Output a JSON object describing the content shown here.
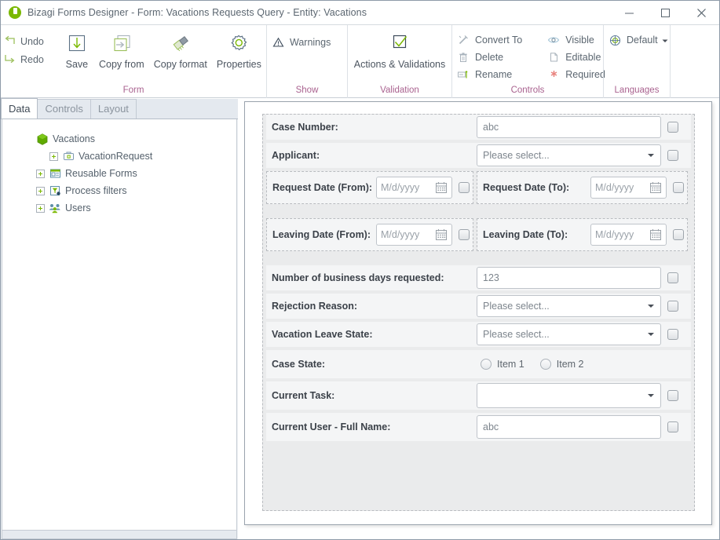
{
  "window": {
    "title": "Bizagi Forms Designer  - Form: Vacations Requests Query - Entity:  Vacations",
    "logo_icon": "bizagi-logo-icon",
    "minimize_label": "Minimize",
    "maximize_label": "Maximize",
    "close_label": "Close"
  },
  "ribbon": {
    "groups": [
      {
        "title": "Form",
        "small_commands": [
          {
            "label": "Undo",
            "icon": "undo-icon"
          },
          {
            "label": "Redo",
            "icon": "redo-icon"
          }
        ],
        "big_commands": [
          {
            "label": "Save",
            "icon": "save-icon"
          },
          {
            "label": "Copy from",
            "icon": "copy-from-icon"
          },
          {
            "label": "Copy format",
            "icon": "copy-format-icon"
          },
          {
            "label": "Properties",
            "icon": "properties-gear-icon"
          }
        ]
      },
      {
        "title": "Show",
        "medium_commands": [
          {
            "label": "Warnings",
            "icon": "warning-triangle-icon"
          }
        ]
      },
      {
        "title": "Validation",
        "big_commands": [
          {
            "label": "Actions & Validations",
            "icon": "checkmark-box-icon"
          }
        ]
      },
      {
        "title": "Controls",
        "medium_commands": [
          {
            "label": "Convert To",
            "icon": "convert-to-icon"
          },
          {
            "label": "Delete",
            "icon": "trash-icon"
          },
          {
            "label": "Rename",
            "icon": "rename-icon"
          },
          {
            "label": "Visible",
            "icon": "eye-icon"
          },
          {
            "label": "Editable",
            "icon": "editable-page-icon"
          },
          {
            "label": "Required",
            "icon": "required-asterisk-icon"
          }
        ]
      },
      {
        "title": "Languages",
        "medium_commands": [
          {
            "label": "Default",
            "icon": "globe-icon"
          }
        ]
      }
    ]
  },
  "sidebar": {
    "tabs": [
      {
        "label": "Data",
        "active": true
      },
      {
        "label": "Controls",
        "active": false
      },
      {
        "label": "Layout",
        "active": false
      }
    ],
    "tree": [
      {
        "label": "Vacations",
        "icon": "entity-hex-icon",
        "indent": 0,
        "expander": false
      },
      {
        "label": "VacationRequest",
        "icon": "collection-icon",
        "indent": 1,
        "expander": true
      },
      {
        "label": "Reusable Forms",
        "icon": "reusable-forms-icon",
        "indent": 0,
        "expander": true
      },
      {
        "label": "Process filters",
        "icon": "filter-icon",
        "indent": 0,
        "expander": true
      },
      {
        "label": "Users",
        "icon": "users-icon",
        "indent": 0,
        "expander": true
      }
    ]
  },
  "form": {
    "rows": [
      {
        "kind": "text",
        "label": "Case Number:",
        "value": "abc",
        "checkbox_icon": "checkbox-icon"
      },
      {
        "kind": "combo",
        "label": "Applicant:",
        "value": "Please select...",
        "checkbox_icon": "checkbox-icon"
      },
      {
        "kind": "date-pair",
        "left": {
          "label": "Request Date (From):",
          "value": "M/d/yyyy",
          "calendar_icon": "calendar-icon",
          "checkbox_icon": "checkbox-icon"
        },
        "right": {
          "label": "Request Date (To):",
          "value": "M/d/yyyy",
          "calendar_icon": "calendar-icon",
          "checkbox_icon": "checkbox-icon"
        }
      },
      {
        "kind": "date-pair",
        "left": {
          "label": "Leaving Date (From):",
          "value": "M/d/yyyy",
          "calendar_icon": "calendar-icon",
          "checkbox_icon": "checkbox-icon"
        },
        "right": {
          "label": "Leaving Date (To):",
          "value": "M/d/yyyy",
          "calendar_icon": "calendar-icon",
          "checkbox_icon": "checkbox-icon"
        }
      },
      {
        "kind": "text",
        "label": "Number of business days requested:",
        "value": "123",
        "checkbox_icon": "checkbox-icon"
      },
      {
        "kind": "combo",
        "label": "Rejection Reason:",
        "value": "Please select...",
        "checkbox_icon": "checkbox-icon"
      },
      {
        "kind": "combo",
        "label": "Vacation Leave State:",
        "value": "Please select...",
        "checkbox_icon": "checkbox-icon"
      },
      {
        "kind": "radio",
        "label": "Case State:",
        "options": [
          "Item 1",
          "Item 2"
        ]
      },
      {
        "kind": "combo",
        "label": "Current Task:",
        "value": "",
        "checkbox_icon": "checkbox-icon"
      },
      {
        "kind": "text",
        "label": "Current User - Full Name:",
        "value": "abc",
        "checkbox_icon": "checkbox-icon"
      }
    ]
  },
  "colors": {
    "brand_green": "#7ab800",
    "group_title": "#a9628f",
    "label_text": "#3b4149",
    "placeholder": "#9aa1a8",
    "panel_bg": "#eaebec",
    "row_bg": "#f4f5f6",
    "required_red": "#e8837e"
  }
}
